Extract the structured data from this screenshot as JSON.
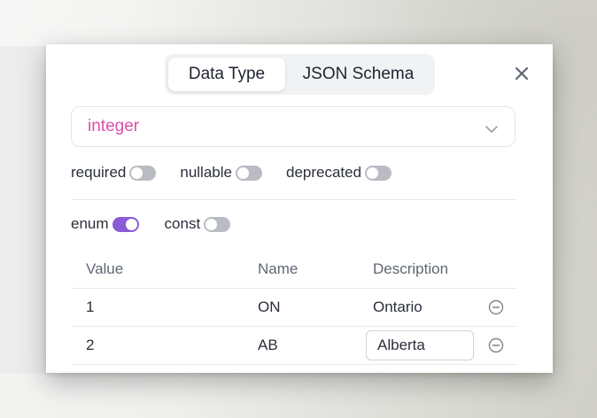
{
  "tabs": [
    {
      "label": "Data Type",
      "active": true
    },
    {
      "label": "JSON Schema",
      "active": false
    }
  ],
  "type_select": {
    "value": "integer"
  },
  "flags": [
    {
      "label": "required",
      "on": false
    },
    {
      "label": "nullable",
      "on": false
    },
    {
      "label": "deprecated",
      "on": false
    }
  ],
  "constraints": [
    {
      "label": "enum",
      "on": true
    },
    {
      "label": "const",
      "on": false
    }
  ],
  "enum_table": {
    "headers": [
      "Value",
      "Name",
      "Description"
    ],
    "rows": [
      {
        "value": "1",
        "name": "ON",
        "description": "Ontario"
      },
      {
        "value": "2",
        "name": "AB",
        "description": "Alberta"
      }
    ]
  },
  "icons": {
    "close": "close-icon",
    "dropdown": "chevron-down-icon",
    "remove": "minus-circle-icon"
  },
  "colors": {
    "accent": "#8a5bd6",
    "type_value": "#dc4fa8",
    "toggle_off": "#b9bcc2"
  }
}
